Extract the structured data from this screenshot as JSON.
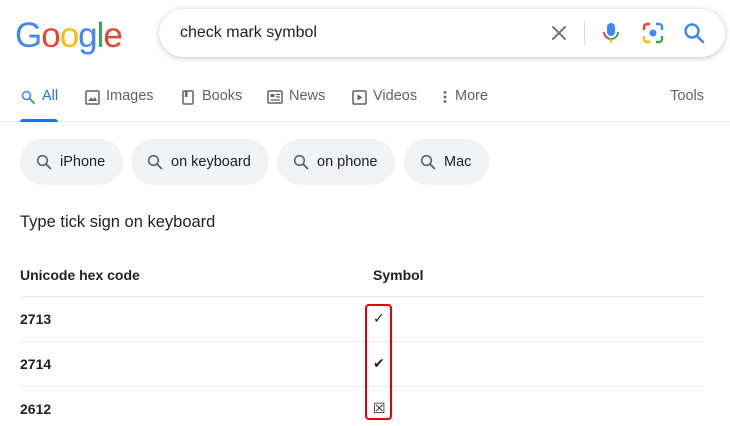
{
  "logo": {
    "letters": [
      "G",
      "o",
      "o",
      "g",
      "l",
      "e"
    ]
  },
  "search": {
    "query": "check mark symbol",
    "icons": {
      "clear": "close-icon",
      "mic": "microphone-icon",
      "lens": "camera-icon",
      "submit": "search-icon"
    }
  },
  "tabs": [
    {
      "label": "All",
      "icon": "search-icon",
      "active": true
    },
    {
      "label": "Images",
      "icon": "image-icon"
    },
    {
      "label": "Books",
      "icon": "book-icon"
    },
    {
      "label": "News",
      "icon": "news-icon"
    },
    {
      "label": "Videos",
      "icon": "play-icon"
    },
    {
      "label": "More",
      "icon": "vertical-dots-icon"
    }
  ],
  "tools_label": "Tools",
  "chips": [
    {
      "label": "iPhone"
    },
    {
      "label": "on keyboard"
    },
    {
      "label": "on phone"
    },
    {
      "label": "Mac"
    }
  ],
  "result": {
    "heading": "Type tick sign on keyboard",
    "columns": [
      "Unicode hex code",
      "Symbol"
    ],
    "rows": [
      {
        "code": "2713",
        "symbol": "✓"
      },
      {
        "code": "2714",
        "symbol": "✔"
      },
      {
        "code": "2612",
        "symbol": "☒"
      }
    ]
  },
  "colors": {
    "accent": "#1a73e8",
    "highlight_border": "#e3000b",
    "chip_bg": "#f1f3f4"
  }
}
